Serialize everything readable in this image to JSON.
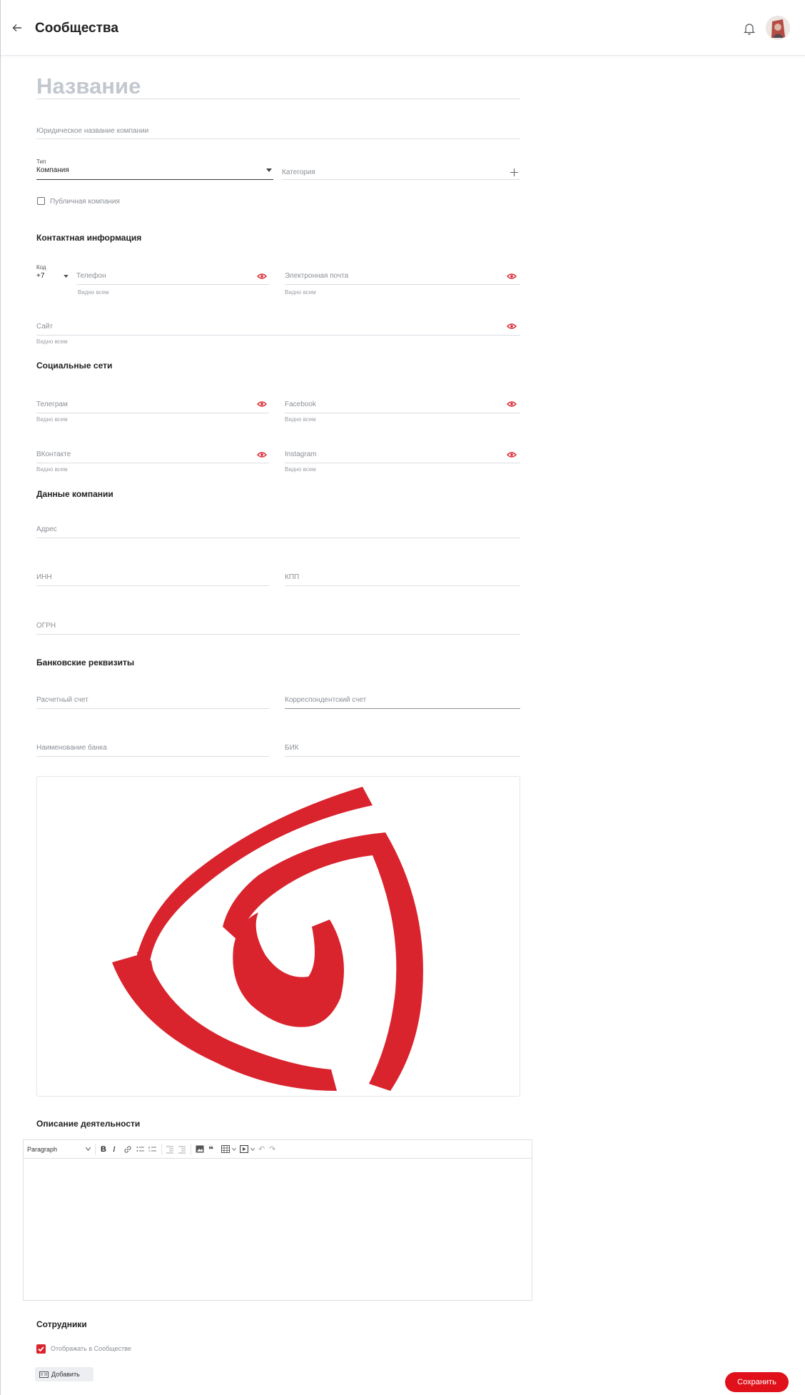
{
  "header": {
    "title": "Сообщества"
  },
  "form": {
    "name_placeholder": "Название",
    "legal_name_placeholder": "Юридическое название компании",
    "type": {
      "label": "Тип",
      "value": "Компания"
    },
    "category_placeholder": "Категория",
    "public_company_label": "Публичная компания"
  },
  "contacts": {
    "title": "Контактная информация",
    "code_label": "Код",
    "code_value": "+7",
    "phone_placeholder": "Телефон",
    "email_placeholder": "Электронная почта",
    "site_placeholder": "Сайт",
    "visibility_hint": "Видно всем"
  },
  "social": {
    "title": "Социальные сети",
    "telegram_placeholder": "Телеграм",
    "facebook_placeholder": "Facebook",
    "vk_placeholder": "ВКонтакте",
    "instagram_placeholder": "Instagram",
    "visibility_hint": "Видно всем"
  },
  "company": {
    "title": "Данные компании",
    "address_placeholder": "Адрес",
    "inn_placeholder": "ИНН",
    "kpp_placeholder": "КПП",
    "ogrn_placeholder": "ОГРН"
  },
  "bank": {
    "title": "Банковские реквизиты",
    "account_placeholder": "Расчетный счет",
    "corr_account_placeholder": "Корреспондентский счет",
    "bank_name_placeholder": "Наименование банка",
    "bik_placeholder": "БИК"
  },
  "description": {
    "title": "Описание деятельности",
    "paragraph_select": "Paragraph"
  },
  "employees": {
    "title": "Сотрудники",
    "show_in_community_label": "Отображать в Сообществе",
    "show_in_community_checked": true,
    "add_label": "Добавить"
  },
  "actions": {
    "save_label": "Сохранить"
  },
  "colors": {
    "accent": "#e0111b",
    "logo_red": "#d9232d",
    "eye_red": "#d9232d"
  },
  "icons": [
    "back-arrow-icon",
    "bell-icon",
    "avatar",
    "chevron-down-icon",
    "plus-icon",
    "eye-icon",
    "bold-icon",
    "italic-icon",
    "link-icon",
    "bullet-list-icon",
    "numbered-list-icon",
    "outdent-icon",
    "indent-icon",
    "image-icon",
    "quote-icon",
    "table-icon",
    "media-icon",
    "undo-icon",
    "redo-icon"
  ]
}
